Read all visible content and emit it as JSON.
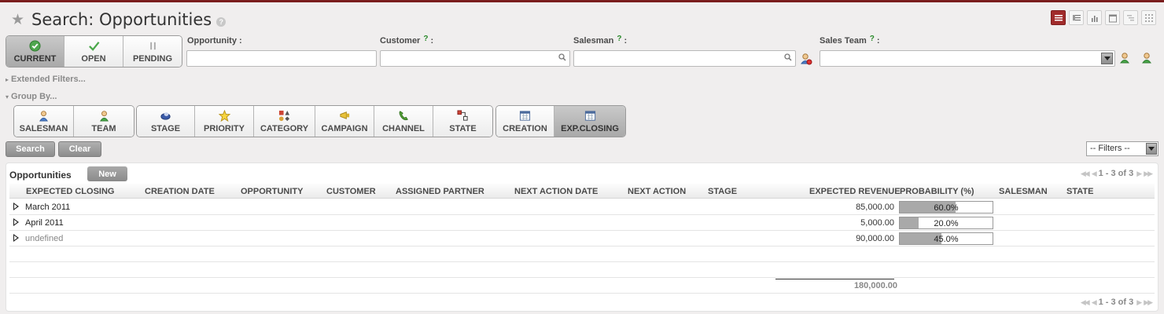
{
  "page": {
    "title": "Search: Opportunities",
    "help": "?",
    "accent_color": "#a12c2c"
  },
  "view_switch": [
    {
      "name": "list-view",
      "icon": "list-icon",
      "active": true
    },
    {
      "name": "form-view",
      "icon": "form-icon",
      "active": false
    },
    {
      "name": "graph-view",
      "icon": "bar-chart-icon",
      "active": false
    },
    {
      "name": "calendar-view",
      "icon": "calendar-icon",
      "active": false
    },
    {
      "name": "gantt-view",
      "icon": "gantt-icon",
      "active": false
    },
    {
      "name": "grid-view",
      "icon": "grid-icon",
      "active": false
    }
  ],
  "state_filters": [
    {
      "label": "CURRENT",
      "icon": "check-circle-icon",
      "active": true
    },
    {
      "label": "OPEN",
      "icon": "checkmark-icon",
      "active": false
    },
    {
      "label": "PENDING",
      "icon": "pause-icon",
      "active": false
    }
  ],
  "fields": {
    "opportunity": {
      "label": "Opportunity :",
      "value": ""
    },
    "customer": {
      "label": "Customer",
      "suffix": ":",
      "value": ""
    },
    "salesman": {
      "label": "Salesman",
      "suffix": ":",
      "value": ""
    },
    "sales_team": {
      "label": "Sales Team",
      "suffix": ":",
      "value": ""
    },
    "help_mark": "?"
  },
  "extended_filters": "Extended Filters...",
  "group_by": {
    "label": "Group By...",
    "groups": [
      [
        {
          "label": "SALESMAN",
          "icon": "user-icon"
        },
        {
          "label": "TEAM",
          "icon": "team-icon"
        }
      ],
      [
        {
          "label": "STAGE",
          "icon": "stage-icon"
        },
        {
          "label": "PRIORITY",
          "icon": "star-icon"
        },
        {
          "label": "CATEGORY",
          "icon": "category-icon"
        },
        {
          "label": "CAMPAIGN",
          "icon": "campaign-icon"
        },
        {
          "label": "CHANNEL",
          "icon": "phone-icon"
        },
        {
          "label": "STATE",
          "icon": "state-icon"
        }
      ],
      [
        {
          "label": "CREATION",
          "icon": "calendar-icon",
          "active": false
        },
        {
          "label": "EXP.CLOSING",
          "icon": "calendar-icon",
          "active": true
        }
      ]
    ]
  },
  "actions": {
    "search": "Search",
    "clear": "Clear",
    "filters_select": "-- Filters --"
  },
  "grid": {
    "title": "Opportunities",
    "new_label": "New",
    "pager_text": "1 - 3 of 3",
    "columns": [
      "EXPECTED CLOSING",
      "CREATION DATE",
      "OPPORTUNITY",
      "CUSTOMER",
      "ASSIGNED PARTNER",
      "NEXT ACTION DATE",
      "NEXT ACTION",
      "STAGE",
      "EXPECTED REVENUE",
      "PROBABILITY (%)",
      "SALESMAN",
      "STATE"
    ],
    "rows": [
      {
        "group": "March 2011",
        "revenue": "85,000.00",
        "probability": "60.0%",
        "probability_value": 60
      },
      {
        "group": "April 2011",
        "revenue": "5,000.00",
        "probability": "20.0%",
        "probability_value": 20
      },
      {
        "group": "undefined",
        "revenue": "90,000.00",
        "probability": "45.0%",
        "probability_value": 45
      }
    ],
    "total_revenue": "180,000.00"
  }
}
